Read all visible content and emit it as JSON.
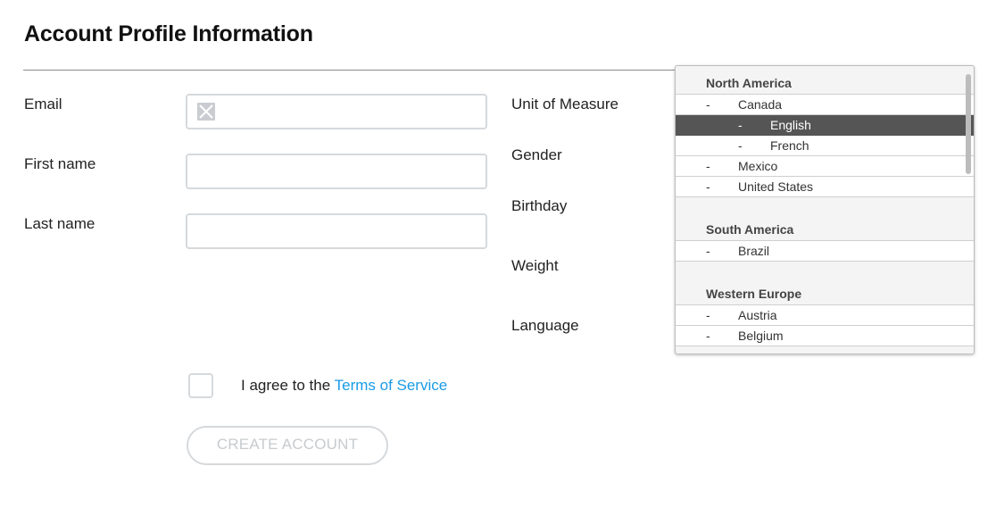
{
  "page": {
    "title": "Account Profile Information"
  },
  "form_left": {
    "email_label": "Email",
    "first_name_label": "First name",
    "last_name_label": "Last name",
    "email_value": "",
    "first_name_value": "",
    "last_name_value": ""
  },
  "form_right": {
    "unit_label": "Unit of Measure",
    "gender_label": "Gender",
    "birthday_label": "Birthday",
    "weight_label": "Weight",
    "language_label": "Language"
  },
  "agreement": {
    "prefix": "I agree to the",
    "link": "Terms of Service",
    "checked": false
  },
  "submit": {
    "label": "CREATE ACCOUNT",
    "disabled": true
  },
  "dropdown": {
    "dash": "-",
    "groups": [
      {
        "name": "North America",
        "items": [
          {
            "label": "Canada",
            "level": 1
          },
          {
            "label": "English",
            "level": 2,
            "selected": true
          },
          {
            "label": "French",
            "level": 2
          },
          {
            "label": "Mexico",
            "level": 1
          },
          {
            "label": "United States",
            "level": 1
          }
        ]
      },
      {
        "name": "South America",
        "items": [
          {
            "label": "Brazil",
            "level": 1
          }
        ]
      },
      {
        "name": "Western Europe",
        "items": [
          {
            "label": "Austria",
            "level": 1
          },
          {
            "label": "Belgium",
            "level": 1
          }
        ]
      }
    ]
  },
  "colors": {
    "link": "#1a9be6",
    "selected_bg": "#555555",
    "field_border": "#d6d9dc"
  },
  "icons": {
    "email_field_icon": "broken-image-icon"
  }
}
